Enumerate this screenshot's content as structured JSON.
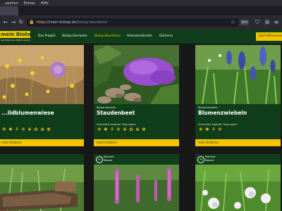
{
  "browser": {
    "menu": [
      "...sechen",
      "Extras",
      "Hilfe"
    ],
    "url_host": "https://mein-biotop.de",
    "url_path": "/biotop-bausteine",
    "zoom": "80%"
  },
  "site": {
    "logo": "mein Biotop",
    "tagline": "Gestalten des NABU Leipzig",
    "nav": [
      "Das Projekt",
      "Biotop Elemente",
      "Biotop-Bausteine",
      "Artensteckbriefe",
      "Gärtnern"
    ],
    "active_nav": "Biotop-Bausteine",
    "cta": "Jetzt Mitmachen"
  },
  "cards": [
    {
      "category": "",
      "title": "...ildblumenwiese",
      "subtitle": "",
      "more": "mehr Erfahren"
    },
    {
      "category": "Biotop-Baustein",
      "title": "Staudenbeet",
      "subtitle": "Unterstützt folgende Tiergruppen:",
      "more": "mehr Erfahren"
    },
    {
      "category": "Biotop-Baustein",
      "title": "Blumenzwiebeln",
      "subtitle": "Unterstützt folgende Tiergruppen:",
      "more": "mehr Erfahren"
    }
  ],
  "cards_row2": [
    {
      "badge": ""
    },
    {
      "badge_line1": "Element",
      "badge_line2": "Wasser"
    },
    {
      "badge_line1": "Element",
      "badge_line2": "Wasser"
    }
  ],
  "colors": {
    "brand_green": "#103e1b",
    "brand_yellow": "#f4c400"
  }
}
